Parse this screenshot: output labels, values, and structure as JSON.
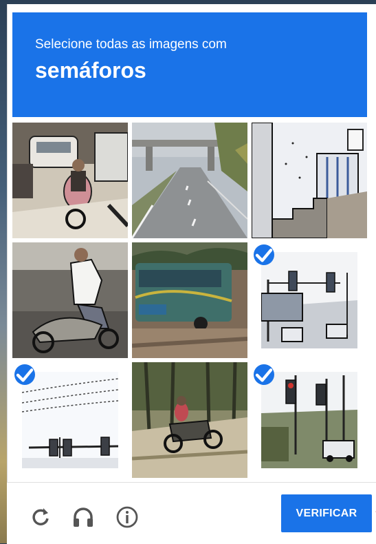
{
  "header": {
    "instruction": "Selecione todas as imagens com",
    "target": "semáforos"
  },
  "tiles": [
    {
      "id": 1,
      "scene": "street with motorbikes and cars",
      "selected": false
    },
    {
      "id": 2,
      "scene": "highway with overpass",
      "selected": false
    },
    {
      "id": 3,
      "scene": "stairs by a house",
      "selected": false
    },
    {
      "id": 4,
      "scene": "man on scooter",
      "selected": false
    },
    {
      "id": 5,
      "scene": "bus on dirt road",
      "selected": false
    },
    {
      "id": 6,
      "scene": "street with traffic lights",
      "selected": true
    },
    {
      "id": 7,
      "scene": "traffic lights under wires",
      "selected": true
    },
    {
      "id": 8,
      "scene": "motorbike among trees",
      "selected": false
    },
    {
      "id": 9,
      "scene": "traffic lights at intersection",
      "selected": true
    }
  ],
  "footer": {
    "reload_icon": "reload-icon",
    "audio_icon": "headphones-icon",
    "info_icon": "info-icon",
    "verify_label": "VERIFICAR"
  },
  "colors": {
    "accent": "#1a73e8",
    "icon_gray": "#555555"
  }
}
